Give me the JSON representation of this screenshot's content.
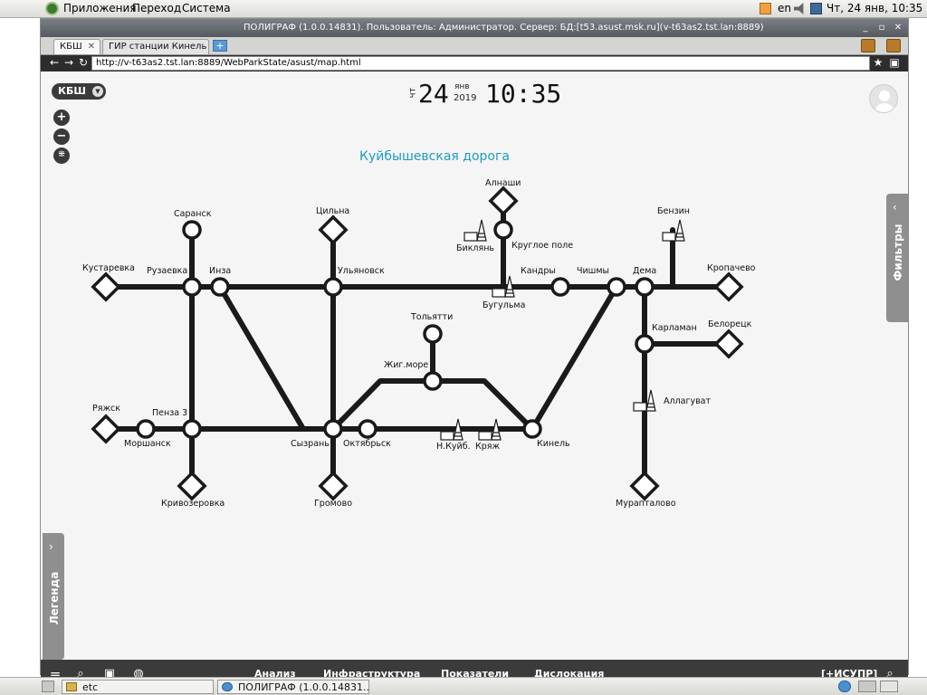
{
  "top_panel": {
    "menu_apps": "Приложения",
    "menu_goto": "Переход",
    "menu_system": "Система",
    "keyboard_layout": "en",
    "datetime": "Чт, 24 янв, 10:35"
  },
  "window": {
    "title": "ПОЛИГРАФ (1.0.0.14831). Пользователь: Администратор. Сервер: БД:[t53.asust.msk.ru](v-t63as2.tst.lan:8889)"
  },
  "tabs": [
    {
      "label": "КБШ",
      "close": "✕"
    },
    {
      "label": "ГИР станции Кинель",
      "close": "✕"
    }
  ],
  "address": {
    "url": "http://v-t63as2.tst.lan:8889/WebParkState/asust/map.html"
  },
  "page": {
    "region_button": "КБШ",
    "clock": {
      "dow": "чт",
      "day": "24",
      "month": "янв",
      "year": "2019",
      "time": "10:35"
    },
    "map_title": "Куйбышевская дорога",
    "filters_label": "Фильтры",
    "legend_label": "Легенда"
  },
  "stations": {
    "saransk": "Саранск",
    "kustarevka": "Кустаревка",
    "ruzaevka": "Рузаевка",
    "inza": "Инза",
    "tsilna": "Цильна",
    "ulyanovsk": "Ульяновск",
    "alnashi": "Алнаши",
    "biklyan": "Биклянь",
    "krugloe_pole": "Круглое поле",
    "bugulma": "Бугульма",
    "kandry": "Кандры",
    "chishmy": "Чишмы",
    "dema": "Дема",
    "benzin": "Бензин",
    "kropachevo": "Кропачево",
    "tolyatti": "Тольятти",
    "zhig_more": "Жиг.море",
    "karlaman": "Карламан",
    "beloretsk": "Белорецк",
    "allaguvat": "Аллагуват",
    "ryazhsk": "Ряжск",
    "penza3": "Пенза 3",
    "morshansk": "Моршанск",
    "syzran": "Сызрань",
    "oktyabrsk": "Октябрьск",
    "n_kuib": "Н.Куйб.",
    "kryazh": "Кряж",
    "kinel": "Кинель",
    "krivozerovka": "Кривозеровка",
    "gromovo": "Громово",
    "murapta": "Мурапталово"
  },
  "bottom_toolbar": {
    "analysis": "Анализ",
    "infrastructure": "Инфраструктура",
    "indicators": "Показатели",
    "dislocation": "Дислокация",
    "isupr": "[+ИСУПР]"
  },
  "taskbar": {
    "task1": "etc",
    "task2": "ПОЛИГРАФ (1.0.0.14831..."
  },
  "colors": {
    "map_line": "#1a1a1a",
    "title_blue": "#1e9bc2",
    "toolbar_dark": "#3b3b3b"
  }
}
